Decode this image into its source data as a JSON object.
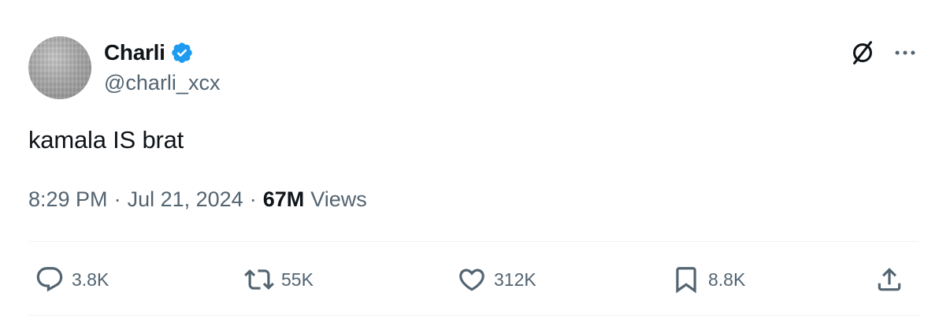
{
  "author": {
    "display_name": "Charli",
    "handle": "@charli_xcx",
    "verified": true,
    "verified_color": "#1d9bf0"
  },
  "tweet": {
    "text": "kamala IS brat",
    "time": "8:29 PM",
    "separator": "·",
    "date": "Jul 21, 2024",
    "views_count": "67M",
    "views_label": "Views"
  },
  "icons": {
    "top_right": [
      "grok-icon",
      "more-icon"
    ],
    "actions": [
      "reply-icon",
      "repost-icon",
      "like-icon",
      "bookmark-icon",
      "share-icon"
    ]
  },
  "engagement": {
    "replies": "3.8K",
    "reposts": "55K",
    "likes": "312K",
    "bookmarks": "8.8K"
  },
  "colors": {
    "text_primary": "#0f1419",
    "text_secondary": "#536471",
    "divider": "#eff3f4"
  }
}
